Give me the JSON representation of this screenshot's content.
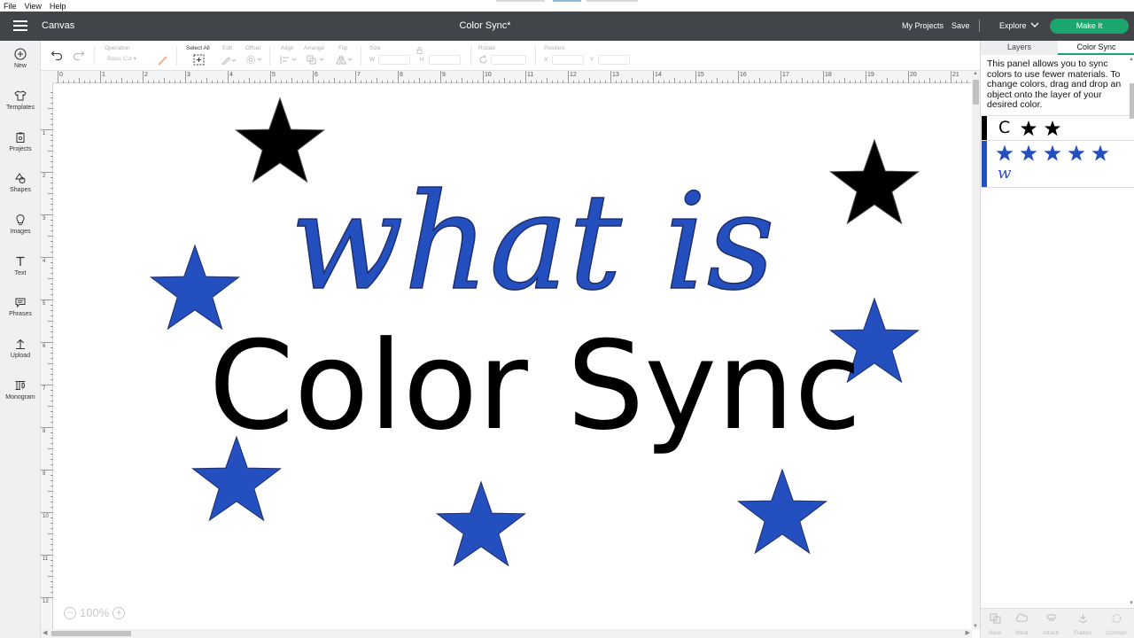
{
  "menu": {
    "items": [
      "File",
      "View",
      "Help"
    ]
  },
  "titlebar": {
    "app_title": "Canvas",
    "doc_title": "Color Sync*",
    "my_projects": "My Projects",
    "save": "Save",
    "separator": "|",
    "explore": "Explore",
    "make_it": "Make It",
    "make_it_color": "#1aa66c"
  },
  "sidebar": {
    "items": [
      {
        "label": "New",
        "icon": "plus-circle-icon"
      },
      {
        "label": "Templates",
        "icon": "shirt-icon"
      },
      {
        "label": "Projects",
        "icon": "clipboard-icon"
      },
      {
        "label": "Shapes",
        "icon": "shapes-icon"
      },
      {
        "label": "Images",
        "icon": "lightbulb-icon"
      },
      {
        "label": "Text",
        "icon": "text-icon"
      },
      {
        "label": "Phrases",
        "icon": "speech-bubble-icon"
      },
      {
        "label": "Upload",
        "icon": "upload-icon"
      },
      {
        "label": "Monogram",
        "icon": "monogram-icon"
      }
    ]
  },
  "toolbar": {
    "operation_label": "Operation",
    "operation_value": "Basic Cut",
    "select_all": "Select All",
    "edit": "Edit",
    "offset": "Offset",
    "align": "Align",
    "arrange": "Arrange",
    "flip": "Flip",
    "size": "Size",
    "size_w": "W",
    "size_h": "H",
    "rotate": "Rotate",
    "position": "Position",
    "pos_x": "X",
    "pos_y": "Y"
  },
  "ruler": {
    "top": [
      "0",
      "1",
      "2",
      "3",
      "4",
      "5",
      "6",
      "7",
      "8",
      "9",
      "10",
      "11",
      "12",
      "13",
      "14",
      "15",
      "16",
      "17",
      "18",
      "19",
      "20",
      "21"
    ],
    "left": [
      "1",
      "2",
      "3",
      "4",
      "5",
      "6",
      "7",
      "8",
      "9",
      "10",
      "11",
      "12"
    ]
  },
  "canvas": {
    "line1": "what is",
    "line2": "Color Sync",
    "blue": "#2450bf",
    "black": "#000000"
  },
  "zoom": {
    "level": "100%",
    "minus": "−",
    "plus": "+"
  },
  "right_panel": {
    "tabs": [
      "Layers",
      "Color Sync"
    ],
    "active_tab": "Color Sync",
    "description": "This panel allows you to sync colors to use fewer materials. To change colors, drag and drop an object onto the layer of your desired color.",
    "swatch_black": {
      "color": "#000000",
      "letter": "C",
      "stars": 2
    },
    "swatch_blue": {
      "color": "#2450bf",
      "letter": "w",
      "stars": 5
    },
    "bottom_tools": [
      "Slice",
      "Weld",
      "Attach",
      "Flatten",
      "Contour"
    ]
  }
}
